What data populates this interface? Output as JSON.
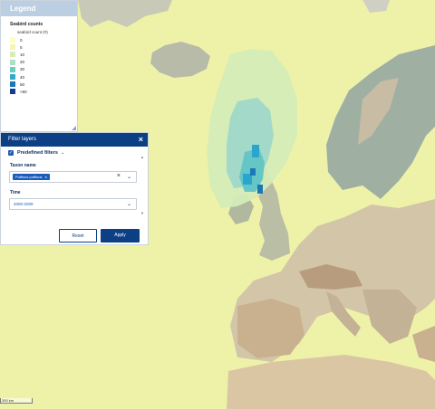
{
  "legend": {
    "header": "Legend",
    "title": "Seabird counts",
    "subtitle": "seabird count (#)",
    "items": [
      {
        "label": "0",
        "color": "#fdfdc4"
      },
      {
        "label": "5",
        "color": "#f3f6b0"
      },
      {
        "label": "10",
        "color": "#d7edb7"
      },
      {
        "label": "20",
        "color": "#aee0c6"
      },
      {
        "label": "30",
        "color": "#6ccbc5"
      },
      {
        "label": "40",
        "color": "#33a9c9"
      },
      {
        "label": "50",
        "color": "#1a78b8"
      },
      {
        "label": ">60",
        "color": "#123e8c"
      }
    ]
  },
  "filter": {
    "header": "Filter layers",
    "close_icon": "×",
    "predefined_label": "Predefined filters",
    "taxon_label": "Taxon name",
    "taxon_tag": "Puffinus puffinus",
    "time_label": "Time",
    "time_value": "2000-2009",
    "reset_label": "Reset",
    "apply_label": "Apply"
  },
  "scale_text": "300 km",
  "colors": {
    "sea": "#eef2a8",
    "land": "#d8c8a8",
    "header_blue": "#0c3f84",
    "legend_header": "#bccfe2"
  }
}
